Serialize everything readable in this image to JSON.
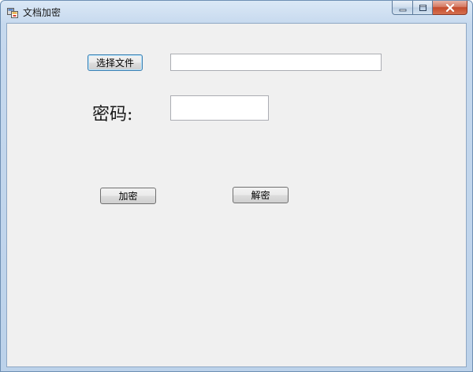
{
  "window": {
    "title": "文档加密",
    "icons": {
      "app": "app-window-icon",
      "minimize": "minimize-icon",
      "maximize": "maximize-icon",
      "close": "close-icon"
    }
  },
  "form": {
    "select_file_label": "选择文件",
    "file_path_value": "",
    "password_label": "密码:",
    "password_value": "",
    "encrypt_label": "加密",
    "decrypt_label": "解密"
  }
}
